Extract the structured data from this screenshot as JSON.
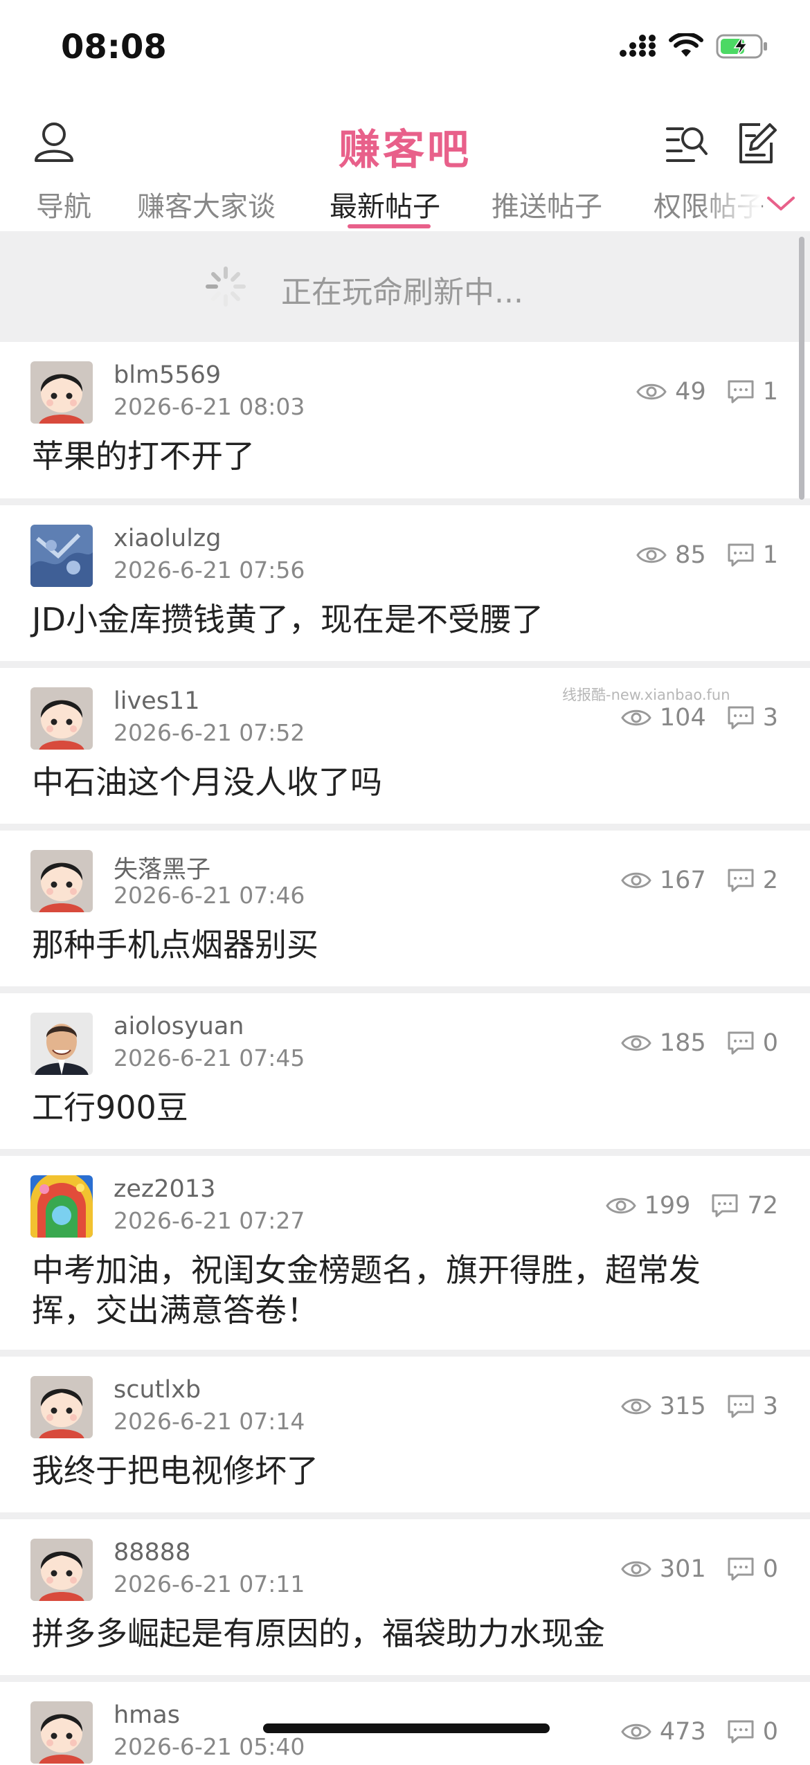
{
  "status_bar": {
    "time": "08:08"
  },
  "header": {
    "title": "赚客吧"
  },
  "tabs": [
    {
      "label": "导航"
    },
    {
      "label": "赚客大家谈"
    },
    {
      "label": "最新帖子"
    },
    {
      "label": "推送帖子"
    },
    {
      "label": "权限帖子"
    }
  ],
  "active_tab": "最新帖子",
  "refresh": {
    "message": "正在玩命刷新中..."
  },
  "watermark": "线报酷-new.xianbao.fun",
  "colors": {
    "accent": "#e8608a",
    "band": "#efeff0",
    "muted": "#888888"
  },
  "posts": [
    {
      "username": "blm5569",
      "time": "2026-6-21 08:03",
      "views": "49",
      "comments": "1",
      "title": "苹果的打不开了",
      "avatar": "cartoon-girl"
    },
    {
      "username": "xiaolulzg",
      "time": "2026-6-21 07:56",
      "views": "85",
      "comments": "1",
      "title": "JD小金库攒钱黄了，现在是不受腰了",
      "avatar": "blue-photo"
    },
    {
      "username": "lives11",
      "time": "2026-6-21 07:52",
      "views": "104",
      "comments": "3",
      "title": "中石油这个月没人收了吗",
      "avatar": "cartoon-girl"
    },
    {
      "username": "失落黑子",
      "time": "2026-6-21 07:46",
      "views": "167",
      "comments": "2",
      "title": "那种手机点烟器别买",
      "avatar": "cartoon-girl"
    },
    {
      "username": "aiolosyuan",
      "time": "2026-6-21 07:45",
      "views": "185",
      "comments": "0",
      "title": "工行900豆",
      "avatar": "man-photo"
    },
    {
      "username": "zez2013",
      "time": "2026-6-21 07:27",
      "views": "199",
      "comments": "72",
      "title": "中考加油，祝闺女金榜题名，旗开得胜，超常发挥，交出满意答卷！",
      "avatar": "colorful-photo"
    },
    {
      "username": "scutlxb",
      "time": "2026-6-21 07:14",
      "views": "315",
      "comments": "3",
      "title": "我终于把电视修坏了",
      "avatar": "cartoon-girl"
    },
    {
      "username": "88888",
      "time": "2026-6-21 07:11",
      "views": "301",
      "comments": "0",
      "title": "拼多多崛起是有原因的，福袋助力水现金",
      "avatar": "cartoon-girl"
    },
    {
      "username": "hmas",
      "time": "2026-6-21 05:40",
      "views": "473",
      "comments": "0",
      "title": "",
      "avatar": "cartoon-girl"
    }
  ]
}
